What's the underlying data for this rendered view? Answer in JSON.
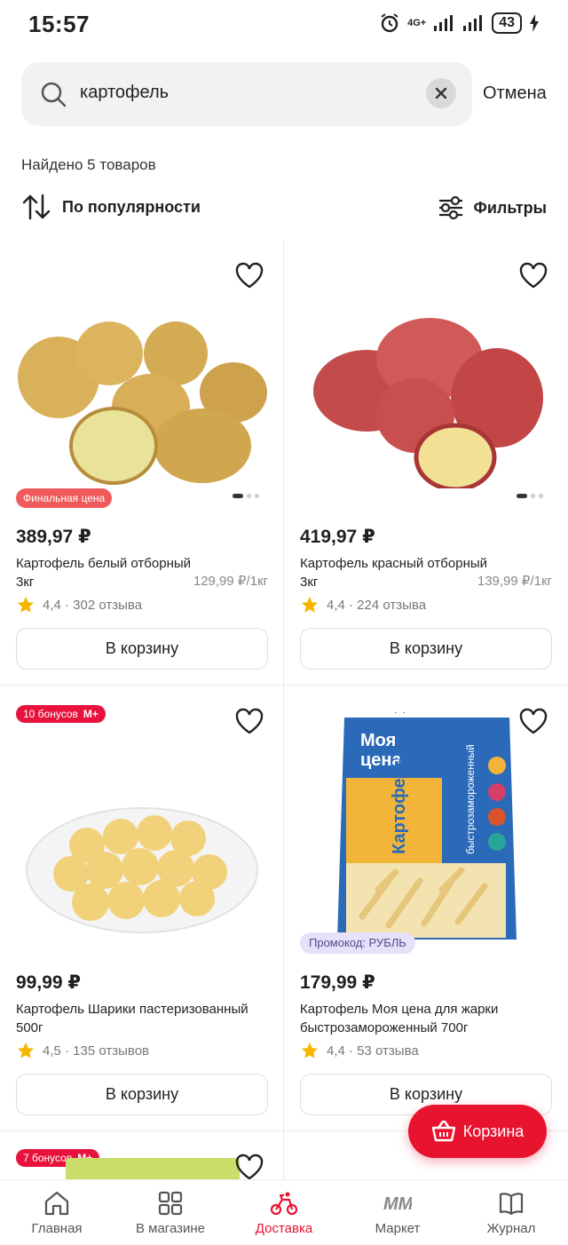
{
  "status": {
    "time": "15:57",
    "network": "4G+",
    "battery": "43"
  },
  "search": {
    "query": "картофель",
    "cancel": "Отмена"
  },
  "results": {
    "found": "Найдено 5 товаров",
    "sort": "По популярности",
    "filters": "Фильтры"
  },
  "products": [
    {
      "badge": "Финальная цена",
      "price": "389,97 ₽",
      "name": "Картофель белый отборный",
      "weight": "3кг",
      "unit_price": "129,99 ₽/1кг",
      "rating": "4,4 · 302 отзыва",
      "cart": "В корзину",
      "image": "white-potatoes"
    },
    {
      "price": "419,97 ₽",
      "name": "Картофель красный отборный",
      "weight": "3кг",
      "unit_price": "139,99 ₽/1кг",
      "rating": "4,4 · 224 отзыва",
      "cart": "В корзину",
      "image": "red-potatoes"
    },
    {
      "bonus": "10 бонусов",
      "bonus_brand": "М+",
      "price": "99,99 ₽",
      "name": "Картофель Шарики пастеризованный 500г",
      "rating": "4,5 · 135 отзывов",
      "cart": "В корзину",
      "image": "potato-balls"
    },
    {
      "promo": "Промокод: РУБЛЬ",
      "price": "179,99 ₽",
      "name": "Картофель Моя цена для жарки быстрозамороженный 700г",
      "rating": "4,4 · 53 отзыва",
      "cart": "В корзину",
      "image": "frozen-fries-pack",
      "pack": {
        "brand_line1": "Моя",
        "brand_line2": "цена",
        "title": "Картофель для жарки",
        "side": "быстрозамороженный"
      }
    },
    {
      "bonus": "7 бонусов",
      "bonus_brand": "М+"
    }
  ],
  "fab": {
    "label": "Корзина"
  },
  "nav": [
    {
      "label": "Главная",
      "icon": "home-icon"
    },
    {
      "label": "В магазине",
      "icon": "grid-icon"
    },
    {
      "label": "Доставка",
      "icon": "bike-icon"
    },
    {
      "label": "Маркет",
      "icon": "market-logo-icon"
    },
    {
      "label": "Журнал",
      "icon": "book-icon"
    }
  ],
  "colors": {
    "accent": "#e8132f",
    "badge": "#f05a5a",
    "promo_bg": "#e6e0f8",
    "star": "#f7b500"
  }
}
